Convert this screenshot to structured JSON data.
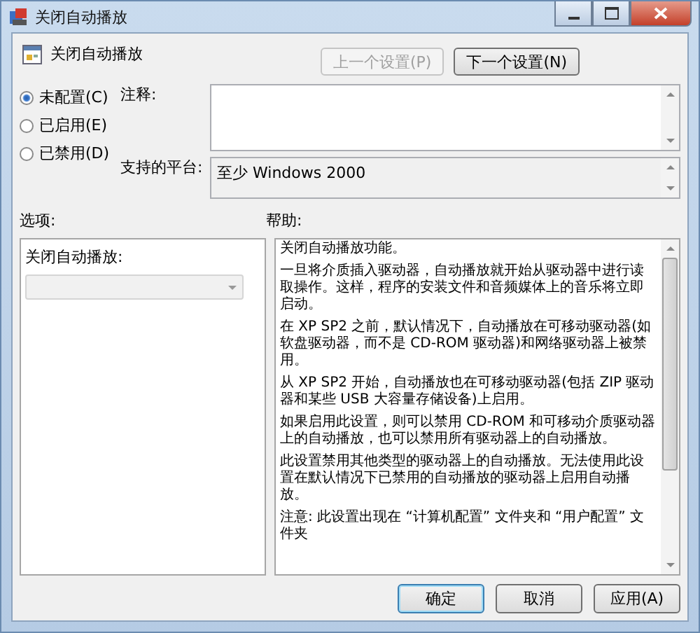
{
  "window": {
    "title": "关闭自动播放"
  },
  "policy": {
    "name": "关闭自动播放"
  },
  "nav_buttons": [
    {
      "label": "上一个设置(P)",
      "disabled": true
    },
    {
      "label": "下一个设置(N)",
      "disabled": false
    }
  ],
  "states": [
    {
      "label": "未配置(C)",
      "selected": true
    },
    {
      "label": "已启用(E)",
      "selected": false
    },
    {
      "label": "已禁用(D)",
      "selected": false
    }
  ],
  "comment": {
    "label": "注释:"
  },
  "platform": {
    "label": "支持的平台:",
    "value": "至少 Windows 2000"
  },
  "options": {
    "label": "选项:",
    "field_label": "关闭自动播放:",
    "dropdown": {
      "disabled": true
    }
  },
  "help": {
    "label": "帮助:",
    "paragraphs": [
      "关闭自动播放功能。",
      "一旦将介质插入驱动器，自动播放就开始从驱动器中进行读取操作。这样，程序的安装文件和音频媒体上的音乐将立即启动。",
      "在 XP SP2 之前，默认情况下，自动播放在可移动驱动器(如软盘驱动器，而不是 CD-ROM 驱动器)和网络驱动器上被禁用。",
      "从 XP SP2 开始，自动播放也在可移动驱动器(包括 ZIP 驱动器和某些 USB 大容量存储设备)上启用。",
      "如果启用此设置，则可以禁用 CD-ROM 和可移动介质驱动器上的自动播放，也可以禁用所有驱动器上的自动播放。",
      "此设置禁用其他类型的驱动器上的自动播放。无法使用此设置在默认情况下已禁用的自动播放的驱动器上启用自动播放。",
      "注意: 此设置出现在 “计算机配置” 文件夹和 “用户配置” 文件夹"
    ]
  },
  "buttons": [
    {
      "label": "确定",
      "default": true
    },
    {
      "label": "取消",
      "default": false
    },
    {
      "label": "应用(A)",
      "default": false
    }
  ]
}
